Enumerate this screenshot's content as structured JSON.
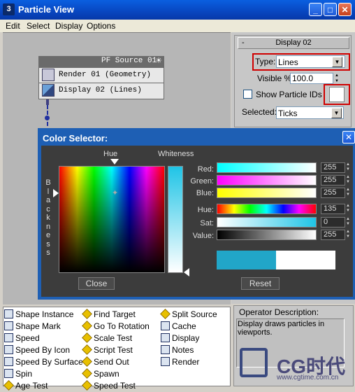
{
  "window": {
    "title": "Particle View",
    "minimize": "_",
    "maximize": "□",
    "close": "✕"
  },
  "menu": [
    "Edit",
    "Select",
    "Display",
    "Options"
  ],
  "display_rollout": {
    "title": "Display 02",
    "collapse": "-",
    "type_label": "Type:",
    "type_value": "Lines",
    "visible_label": "Visible %",
    "visible_value": "100.0",
    "show_ids_label": "Show Particle IDs",
    "selected_label": "Selected:",
    "selected_value": "Ticks"
  },
  "pf_source": {
    "title": "PF Source 01",
    "rows": [
      "Render 01 (Geometry)",
      "Display 02 (Lines)"
    ]
  },
  "color_selector": {
    "title": "Color Selector:",
    "hue_label": "Hue",
    "whiteness_label": "Whiteness",
    "blackness_label": "Blackness",
    "channels": [
      {
        "label": "Red:",
        "value": "255"
      },
      {
        "label": "Green:",
        "value": "255"
      },
      {
        "label": "Blue:",
        "value": "255"
      },
      {
        "label": "Hue:",
        "value": "135"
      },
      {
        "label": "Sat:",
        "value": "0"
      },
      {
        "label": "Value:",
        "value": "255"
      }
    ],
    "close_button": "Close",
    "reset_button": "Reset",
    "colors": {
      "previous": "#21a6c8",
      "current": "#ffffff"
    }
  },
  "operators": [
    [
      "Shape Instance",
      "Find Target",
      "Split Source"
    ],
    [
      "Shape Mark",
      "Go To Rotation",
      "Cache"
    ],
    [
      "Speed",
      "Scale Test",
      "Display"
    ],
    [
      "Speed By Icon",
      "Script Test",
      "Notes"
    ],
    [
      "Speed By Surface",
      "Send Out",
      "Render"
    ],
    [
      "Spin",
      "Spawn",
      ""
    ],
    [
      "Age Test",
      "Speed Test",
      ""
    ]
  ],
  "description": {
    "title": "Operator Description:",
    "text": "Display draws particles in viewports."
  },
  "watermark": {
    "logo": "CG时代",
    "url": "www.cgtime.com.cn"
  }
}
